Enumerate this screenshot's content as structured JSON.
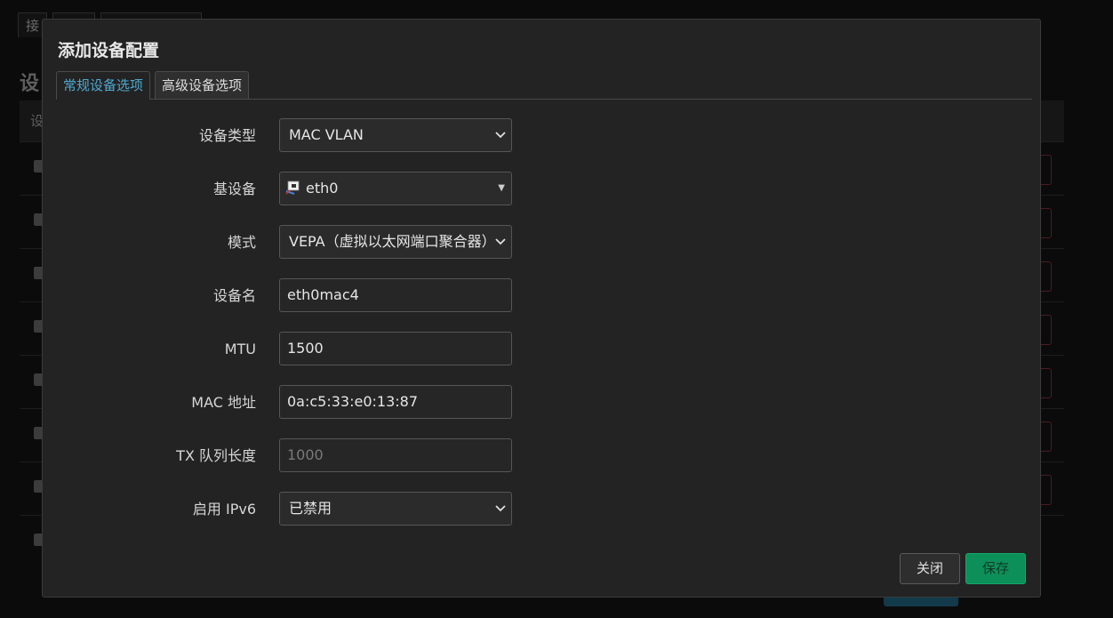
{
  "background": {
    "tabs": [
      "接",
      "",
      ""
    ],
    "heading": "设",
    "table_header": "设",
    "row_count": 8,
    "accent_colors": {
      "danger_border": "#4a1c22",
      "primary_button": "#123a4a"
    }
  },
  "modal": {
    "title": "添加设备配置",
    "tabs": [
      {
        "label": "常规设备选项",
        "active": true
      },
      {
        "label": "高级设备选项",
        "active": false
      }
    ],
    "fields": {
      "device_type": {
        "label": "设备类型",
        "value": "MAC VLAN",
        "type": "select"
      },
      "base_device": {
        "label": "基设备",
        "value": "eth0",
        "type": "dropdown",
        "icon": "ethernet-port-icon"
      },
      "mode": {
        "label": "模式",
        "value": "VEPA（虚拟以太网端口聚合器）",
        "type": "select"
      },
      "device_name": {
        "label": "设备名",
        "value": "eth0mac4",
        "type": "text"
      },
      "mtu": {
        "label": "MTU",
        "value": "1500",
        "type": "text"
      },
      "mac_address": {
        "label": "MAC 地址",
        "value": "0a:c5:33:e0:13:87",
        "type": "text"
      },
      "tx_queue_length": {
        "label": "TX 队列长度",
        "value": "",
        "placeholder": "1000",
        "type": "text"
      },
      "enable_ipv6": {
        "label": "启用 IPv6",
        "value": "已禁用",
        "type": "select"
      }
    },
    "buttons": {
      "close": "关闭",
      "save": "保存"
    },
    "colors": {
      "active_tab_text": "#4ea9d1",
      "save_button_bg": "#0c8f58",
      "modal_bg": "#232323"
    }
  }
}
